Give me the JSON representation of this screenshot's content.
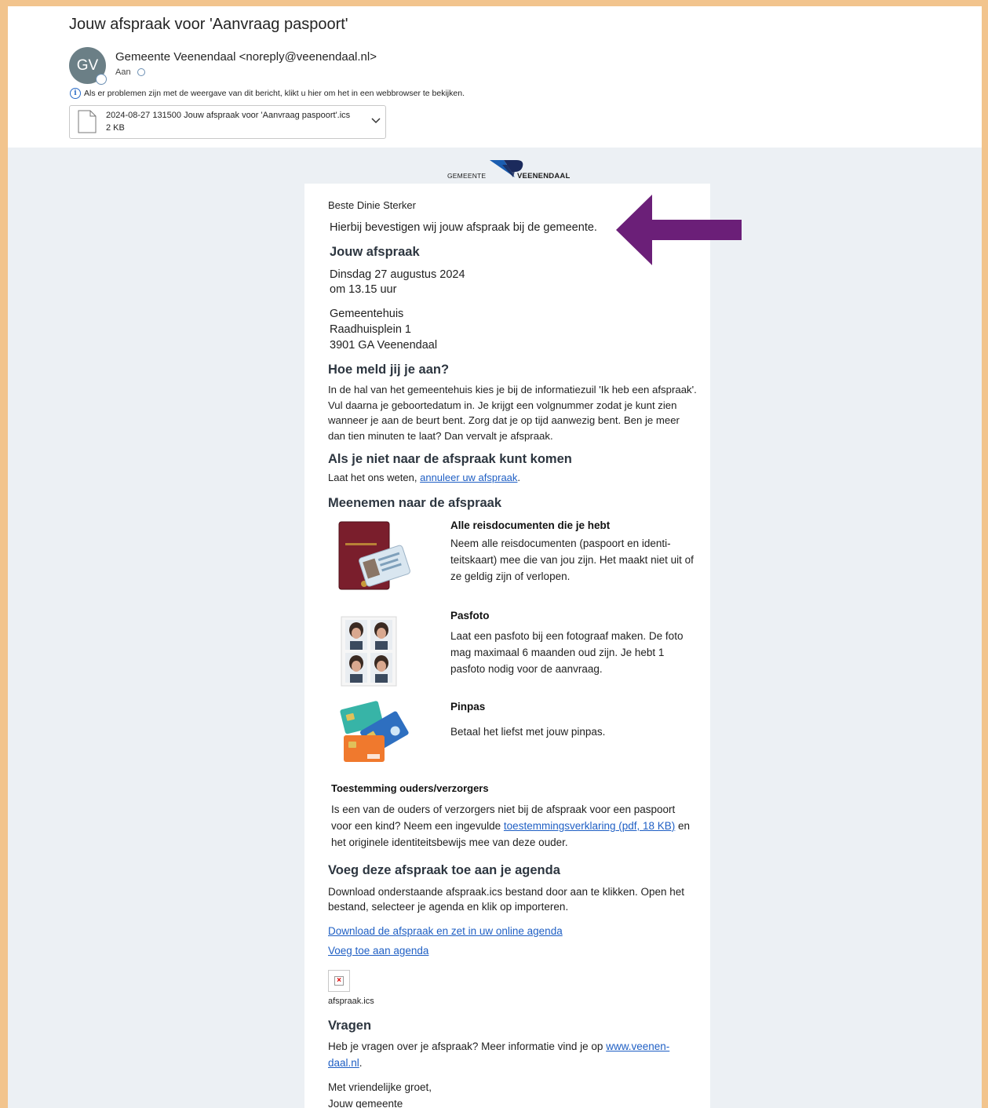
{
  "email": {
    "subject": "Jouw afspraak voor 'Aanvraag paspoort'",
    "avatar_initials": "GV",
    "sender": "Gemeente Veenendaal <noreply@veenendaal.nl>",
    "to_label": "Aan",
    "info_banner": "Als er problemen zijn met de weergave van dit bericht, klikt u hier om het in een webbrowser te bekijken.",
    "attachment": {
      "name": "2024-08-27 131500 Jouw afspraak voor 'Aanvraag paspoort'.ics",
      "size": "2 KB"
    }
  },
  "logo": {
    "left": "GEMEENTE",
    "right": "VEENENDAAL",
    "colors": {
      "blue": "#1a5db0",
      "navy": "#1b2a5c"
    }
  },
  "content": {
    "greeting": "Beste Dinie Sterker",
    "confirm": "Hierbij bevestigen wij jouw afspraak bij de gemeente.",
    "appointment_heading": "Jouw afspraak",
    "date": "Dinsdag 27 augustus 2024",
    "time": "om 13.15 uur",
    "location_name": "Gemeentehuis",
    "address": "Raadhuisplein 1",
    "city": "3901 GA Veenendaal",
    "checkin_heading": "Hoe meld jij je aan?",
    "checkin_text": "In de hal van het gemeentehuis kies je bij de informatiezuil 'Ik heb een afspraak'. Vul daarna je geboortedatum in. Je krijgt een volgnummer zodat je kunt zien wanneer je aan de beurt bent. Zorg dat je op tijd aanwezig bent. Ben je meer dan tien minuten te laat? Dan vervalt je afspraak.",
    "cancel_heading": "Als je niet naar de afspraak kunt komen",
    "cancel_text": "Laat het ons weten,",
    "cancel_link": "annuleer uw afspraak",
    "cancel_end": ".",
    "bring_heading": "Meenemen naar de afspraak",
    "items": [
      {
        "title": "Alle reisdocumenten die je hebt",
        "text": "Neem alle reisdocumenten (paspoort en identi-teitskaart) mee die van jou zijn. Het maakt niet uit of ze geldig zijn of verlopen.",
        "image": "passport-image"
      },
      {
        "title": "Pasfoto",
        "text": "Laat een pasfoto bij een fotograaf maken. De foto mag maximaal 6 maanden oud zijn. Je hebt 1 pasfoto nodig voor de aanvraag.",
        "image": "passport-photo-image"
      },
      {
        "title": "Pinpas",
        "text": "Betaal het liefst met jouw pinpas.",
        "image": "bank-cards-image"
      }
    ],
    "consent_heading": "Toestemming ouders/verzorgers",
    "consent_text_1": "Is een van de ouders of verzorgers niet bij de afspraak voor een paspoort voor een kind? Neem een ingevulde",
    "consent_link": "toestemmingsverklaring (pdf, 18 KB)",
    "consent_text_2": "en het originele identiteitsbewijs mee van deze ouder.",
    "agenda_heading": "Voeg deze afspraak toe aan je agenda",
    "agenda_text": "Download onderstaande afspraak.ics bestand door aan te klikken. Open het bestand, selecteer je agenda en klik op importeren.",
    "agenda_link_1": "Download de afspraak en zet in uw online agenda",
    "agenda_link_2": "Voeg toe aan agenda",
    "ics_label": "afspraak.ics",
    "questions_heading": "Vragen",
    "questions_text": "Heb je vragen over je afspraak? Meer informatie vind je op",
    "questions_link_1": "www.veenen-",
    "questions_link_2": "daal.nl",
    "questions_end": ".",
    "closing_1": "Met vriendelijke groet,",
    "closing_2": "Jouw gemeente"
  },
  "annotation": {
    "arrow_color": "#6b1f78"
  }
}
